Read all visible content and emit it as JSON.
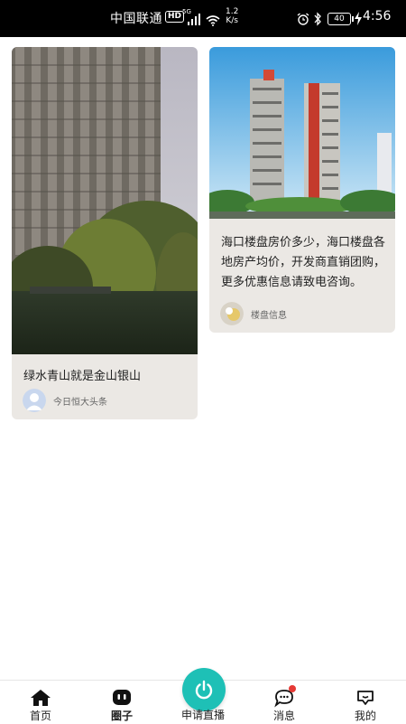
{
  "status_bar": {
    "carrier": "中国联通",
    "hd": "HD",
    "network": "5G",
    "speed_value": "1.2",
    "speed_unit": "K/s",
    "battery": "40",
    "time": "4:56"
  },
  "feed": {
    "cards": [
      {
        "title": "绿水青山就是金山银山",
        "author": "今日恒大头条"
      },
      {
        "title": "海口楼盘房价多少，海口楼盘各地房产均价，开发商直销团购，更多优惠信息请致电咨询。",
        "author": "楼盘信息"
      }
    ]
  },
  "bottom_nav": {
    "items": [
      {
        "label": "首页",
        "icon": "home-icon"
      },
      {
        "label": "圈子",
        "icon": "circle-icon"
      },
      {
        "label": "申请直播",
        "icon": "power-icon"
      },
      {
        "label": "消息",
        "icon": "message-icon"
      },
      {
        "label": "我的",
        "icon": "profile-icon"
      }
    ],
    "accent": "#1ec0b6",
    "badge_color": "#e53935"
  }
}
